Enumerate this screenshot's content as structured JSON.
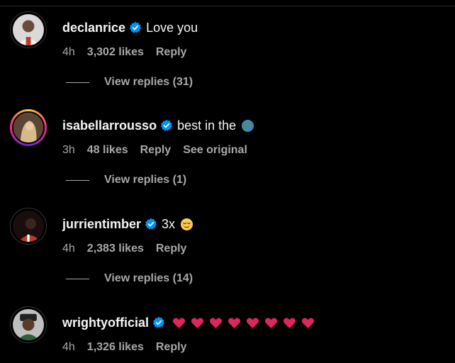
{
  "comments": [
    {
      "username": "declanrice",
      "text": "Love you",
      "time": "4h",
      "likes": "3,302 likes",
      "reply": "Reply",
      "view_replies": "View replies (31)"
    },
    {
      "username": "isabellarrousso",
      "text": "best in the",
      "emoji": "globe-emoji",
      "time": "3h",
      "likes": "48 likes",
      "reply": "Reply",
      "see_original": "See original",
      "view_replies": "View replies (1)"
    },
    {
      "username": "jurrientimber",
      "text": "3x",
      "emoji": "relieved-face-emoji",
      "time": "4h",
      "likes": "2,383 likes",
      "reply": "Reply",
      "view_replies": "View replies (14)"
    },
    {
      "username": "wrightyofficial",
      "emoji": "red-heart-emoji",
      "heart_count": 8,
      "time": "4h",
      "likes": "1,326 likes",
      "reply": "Reply"
    }
  ],
  "colors": {
    "background": "#000000",
    "primary_text": "#f5f5f5",
    "secondary_text": "#a8a8a8",
    "verified": "#0095f6",
    "heart": "#e0245e"
  }
}
